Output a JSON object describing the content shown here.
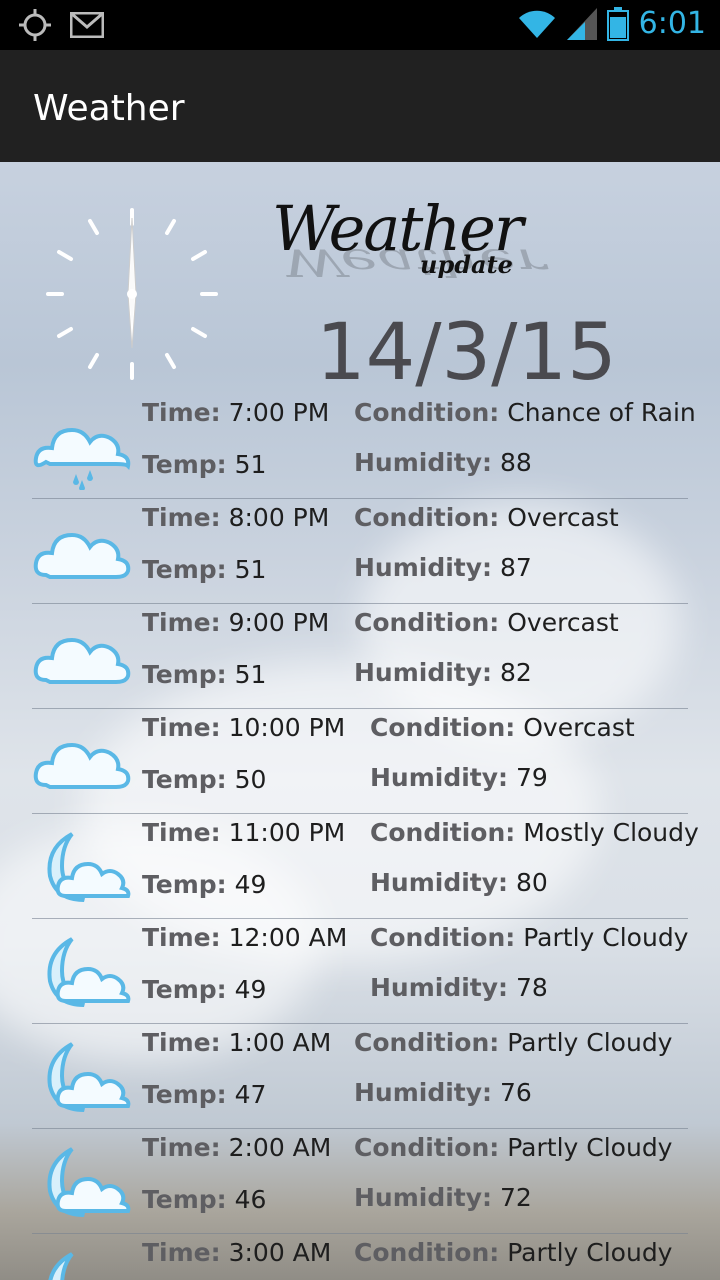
{
  "status_bar": {
    "time": "6:01",
    "icons": [
      "location-icon",
      "gmail-icon",
      "wifi-icon",
      "signal-icon",
      "battery-icon"
    ],
    "accent_color": "#33b5e5"
  },
  "app_bar": {
    "title": "Weather"
  },
  "header": {
    "logo_text": "Weather",
    "logo_sub": "update",
    "date": "14/3/15"
  },
  "labels": {
    "time": "Time:",
    "temp": "Temp:",
    "condition": "Condition:",
    "humidity": "Humidity:"
  },
  "forecast": [
    {
      "time": "7:00 PM",
      "temp": "51",
      "condition": "Chance of Rain",
      "humidity": "88",
      "icon": "rain-cloud-icon"
    },
    {
      "time": "8:00 PM",
      "temp": "51",
      "condition": "Overcast",
      "humidity": "87",
      "icon": "cloud-icon"
    },
    {
      "time": "9:00 PM",
      "temp": "51",
      "condition": "Overcast",
      "humidity": "82",
      "icon": "cloud-icon"
    },
    {
      "time": "10:00 PM",
      "temp": "50",
      "condition": "Overcast",
      "humidity": "79",
      "icon": "cloud-icon"
    },
    {
      "time": "11:00 PM",
      "temp": "49",
      "condition": "Mostly Cloudy",
      "humidity": "80",
      "icon": "moon-cloud-icon"
    },
    {
      "time": "12:00 AM",
      "temp": "49",
      "condition": "Partly Cloudy",
      "humidity": "78",
      "icon": "moon-cloud-icon"
    },
    {
      "time": "1:00 AM",
      "temp": "47",
      "condition": "Partly Cloudy",
      "humidity": "76",
      "icon": "moon-cloud-icon"
    },
    {
      "time": "2:00 AM",
      "temp": "46",
      "condition": "Partly Cloudy",
      "humidity": "72",
      "icon": "moon-cloud-icon"
    },
    {
      "time": "3:00 AM",
      "temp": "",
      "condition": "Partly Cloudy",
      "humidity": "",
      "icon": "moon-cloud-icon"
    }
  ]
}
